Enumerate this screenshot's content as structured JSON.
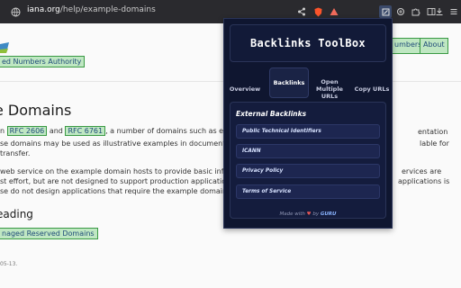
{
  "browser": {
    "url_domain": "iana.org",
    "url_path": "/help/example-domains",
    "icons": [
      "globe-icon",
      "share-icon",
      "brave-icon",
      "warning-icon",
      "extension-icon",
      "extension-active-icon",
      "puzzle-icon",
      "sidebar-icon",
      "download-icon",
      "menu-icon"
    ]
  },
  "page": {
    "authority": "ed Numbers Authority",
    "nav": {
      "numbers": "umbers",
      "about": "About"
    },
    "h1": "e Domains",
    "para1": {
      "pre": "n",
      "rfc2606": "RFC 2606",
      "and": "and",
      "rfc6761": "RFC 6761",
      "post": ", a number of domains such as exampl",
      "right_end": "entation"
    },
    "para1_line2": {
      "left": "se domains may be used as illustrative examples in documents wi",
      "right": "lable for"
    },
    "para1_line3": "transfer.",
    "para2": {
      "line1_left": "web service on the example domain hosts to provide basic inform",
      "line1_right": "ervices are",
      "line2_left": "st effort, but are not designed to support production applications",
      "line2_right": "applications is",
      "line3": "se do not design applications that require the example domains t"
    },
    "h2": "eading",
    "reserved": "naged Reserved Domains",
    "date": "05-13."
  },
  "popup": {
    "title": "Backlinks ToolBox",
    "tabs": [
      {
        "label": "Overview",
        "active": false
      },
      {
        "label": "Backlinks",
        "active": true
      },
      {
        "label": "Open Multiple URLs",
        "active": false
      },
      {
        "label": "Copy URLs",
        "active": false
      }
    ],
    "section_title": "External Backlinks",
    "links": [
      "Public Technical Identifiers",
      "ICANN",
      "Privacy Policy",
      "Terms of Service"
    ],
    "footer": {
      "made_with": "Made with",
      "by": "by",
      "author": "GURU"
    }
  }
}
